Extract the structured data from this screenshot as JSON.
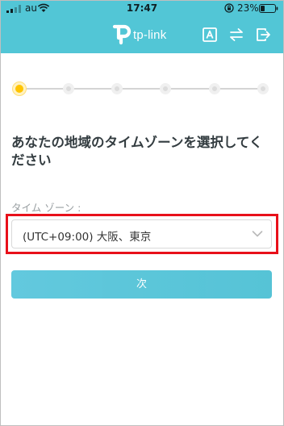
{
  "status_bar": {
    "carrier": "au",
    "time": "17:47",
    "battery_percent": "23%",
    "icons": [
      "cellular-signal-icon",
      "wifi-icon",
      "rotation-lock-icon",
      "battery-icon"
    ]
  },
  "header": {
    "logo_text": "tp-link",
    "icons": [
      "language-icon",
      "switch-icon",
      "exit-icon"
    ]
  },
  "stepper": {
    "total_steps": 6,
    "current_step": 1
  },
  "main": {
    "heading": "あなたの地域のタイムゾーンを選択してください",
    "timezone_label": "タイム ゾーン :",
    "timezone_value": "(UTC+09:00) 大阪、東京",
    "next_label": "次"
  },
  "colors": {
    "header_background": "#52c6d6",
    "active_step": "#ffc400",
    "highlight_border": "#e8101a",
    "button_background": "#52c4da"
  }
}
